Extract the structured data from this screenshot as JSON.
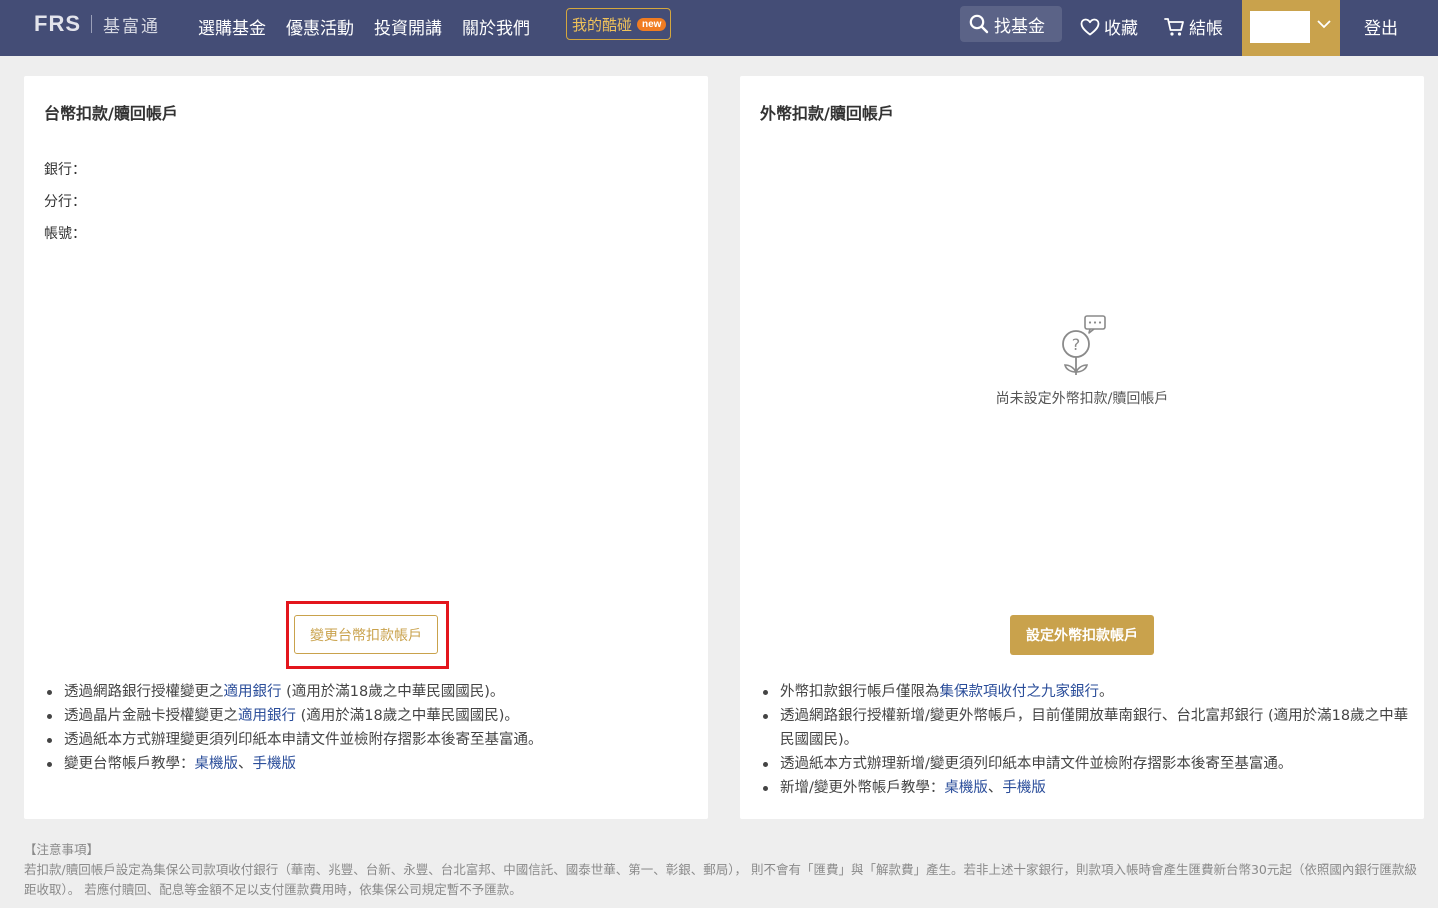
{
  "header": {
    "logo_mark": "FRS",
    "logo_text": "基富通",
    "nav": [
      "選購基金",
      "優惠活動",
      "投資開講",
      "關於我們"
    ],
    "coupon_label": "我的酷碰",
    "coupon_badge": "new",
    "search_label": "找基金",
    "favorites_label": "收藏",
    "cart_label": "結帳",
    "logout_label": "登出",
    "accent_color": "#c9a24c",
    "bar_color": "#444d76"
  },
  "twd_card": {
    "title": "台幣扣款/贖回帳戶",
    "bank_label": "銀行：",
    "bank_value": "",
    "branch_label": "分行：",
    "branch_value": "",
    "account_label": "帳號：",
    "account_value": "",
    "change_button": "變更台幣扣款帳戶",
    "notes": {
      "n1_pre": "透過網路銀行授權變更之",
      "n1_link": "適用銀行",
      "n1_post": " (適用於滿18歲之中華民國國民)。",
      "n2_pre": "透過晶片金融卡授權變更之",
      "n2_link": "適用銀行",
      "n2_post": " (適用於滿18歲之中華民國國民)。",
      "n3": "透過紙本方式辦理變更須列印紙本申請文件並檢附存摺影本後寄至基富通。",
      "n4_pre": "變更台幣帳戶教學：",
      "n4_link1": "桌機版",
      "n4_sep": "、",
      "n4_link2": "手機版"
    }
  },
  "fx_card": {
    "title": "外幣扣款/贖回帳戶",
    "empty_icon": "question-flower-icon",
    "empty_text": "尚未設定外幣扣款/贖回帳戶",
    "set_button": "設定外幣扣款帳戶",
    "notes": {
      "n1_pre": "外幣扣款銀行帳戶僅限為",
      "n1_link": "集保款項收付之九家銀行",
      "n1_post": "。",
      "n2": "透過網路銀行授權新增/變更外幣帳戶，目前僅開放華南銀行、台北富邦銀行 (適用於滿18歲之中華民國國民)。",
      "n3": "透過紙本方式辦理新增/變更須列印紙本申請文件並檢附存摺影本後寄至基富通。",
      "n4_pre": "新增/變更外幣帳戶教學：",
      "n4_link1": "桌機版",
      "n4_sep": "、",
      "n4_link2": "手機版"
    }
  },
  "notice": {
    "title": "【注意事項】",
    "body": "若扣款/贖回帳戶設定為集保公司款項收付銀行（華南、兆豐、台新、永豐、台北富邦、中國信託、國泰世華、第一、彰銀、郵局）， 則不會有「匯費」與「解款費」產生。若非上述十家銀行，則款項入帳時會產生匯費新台幣30元起（依照國內銀行匯款級距收取）。 若應付贖回、配息等金額不足以支付匯款費用時，依集保公司規定暫不予匯款。"
  }
}
